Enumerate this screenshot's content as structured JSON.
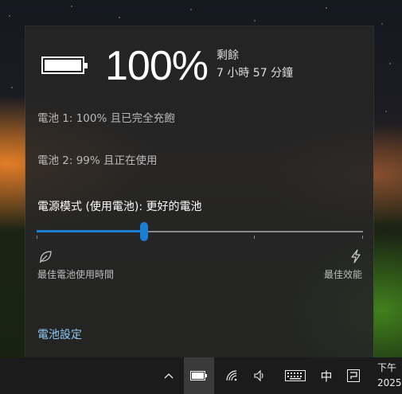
{
  "battery": {
    "percent": "100%",
    "remaining_label": "剩餘",
    "remaining_time": "7 小時 57 分鐘",
    "battery1_status": "電池 1: 100% 且已完全充飽",
    "battery2_status": "電池 2: 99% 且正在使用"
  },
  "power_mode": {
    "label": "電源模式 (使用電池): 更好的電池",
    "slider_level": 0.33,
    "left_label": "最佳電池使用時間",
    "right_label": "最佳效能"
  },
  "settings_link": "電池設定",
  "taskbar": {
    "ime_label": "中",
    "clock_line1": "下午",
    "clock_line2": "2025"
  },
  "colors": {
    "accent": "#1a7ed4",
    "link": "#8dc9f7",
    "flyout_bg": "#262626"
  },
  "icons": [
    "battery-icon",
    "leaf-icon",
    "bolt-icon",
    "chevron-up-icon",
    "battery-tray-icon",
    "wifi-icon",
    "volume-icon",
    "keyboard-icon",
    "ime-icon"
  ]
}
